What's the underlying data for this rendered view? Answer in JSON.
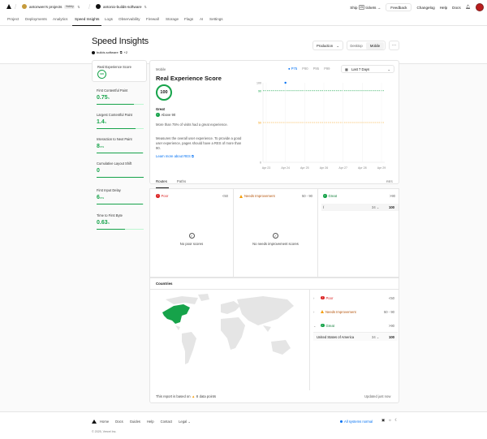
{
  "topbar": {
    "team_name": "antonwen's projects",
    "team_plan": "Hobby",
    "project_name": "antonio-builds-software",
    "ship_label": "Ship",
    "ship_badge": "25",
    "tickets_label": "tickets →",
    "feedback_label": "Feedback",
    "changelog_label": "Changelog",
    "help_label": "Help",
    "docs_label": "Docs"
  },
  "tabs": [
    "Project",
    "Deployments",
    "Analytics",
    "Speed Insights",
    "Logs",
    "Observability",
    "Firewall",
    "Storage",
    "Flags",
    "AI",
    "Settings"
  ],
  "active_tab": "Speed Insights",
  "header": {
    "title": "Speed Insights",
    "domain": "builds.software",
    "domain_extra": "+2",
    "environment": "Production",
    "device_options": [
      "Desktop",
      "Mobile"
    ],
    "device_selected": "Mobile"
  },
  "sidebar": {
    "metrics": [
      {
        "name": "Real Experience Score",
        "value": "100",
        "unit": "",
        "progress": 1.0
      },
      {
        "name": "First Contentful Paint",
        "value": "0.75",
        "unit": "s",
        "progress": 0.8
      },
      {
        "name": "Largest Contentful Paint",
        "value": "1.4",
        "unit": "s",
        "progress": 0.82
      },
      {
        "name": "Interaction to Next Paint",
        "value": "8",
        "unit": "ms",
        "progress": 0.98
      },
      {
        "name": "Cumulative Layout Shift",
        "value": "0",
        "unit": "",
        "progress": 1.0
      },
      {
        "name": "First Input Delay",
        "value": "6",
        "unit": "ms",
        "progress": 0.98
      },
      {
        "name": "Time to First Byte",
        "value": "0.63",
        "unit": "s",
        "progress": 0.6
      }
    ]
  },
  "panel": {
    "device_label": "Mobile",
    "title": "Real Experience Score",
    "score": "100",
    "rating": "Great",
    "above": "Above 90",
    "description": "More than 75% of visits had a great experience.",
    "explanation": "Measures the overall user experience. To provide a good user experience, pages should have a RES of more than 90.",
    "learn_more": "Learn more about RES ⧉",
    "percentiles": [
      "P75",
      "P90",
      "P95",
      "P99"
    ],
    "percentile_selected": "P75",
    "range": "Last 7 Days"
  },
  "chart_data": {
    "type": "line",
    "x": [
      "Apr 23",
      "Apr 24",
      "Apr 25",
      "Apr 26",
      "Apr 27",
      "Apr 28",
      "Apr 29"
    ],
    "series": [
      {
        "values": [
          null,
          100,
          null,
          null,
          null,
          null,
          null
        ]
      }
    ],
    "ylim": [
      0,
      100
    ],
    "yticks": [
      0,
      50,
      90,
      100
    ],
    "thresholds": [
      {
        "value": 90,
        "color": "#16a34a"
      },
      {
        "value": 50,
        "color": "#f59e0b"
      }
    ],
    "accent": "#0070f3"
  },
  "routes": {
    "tabs": [
      "Routes",
      "Paths"
    ],
    "selected": "Routes",
    "metric_tag": "RES",
    "buckets": [
      {
        "label": "Poor",
        "range": "<50",
        "empty_text": "No poor scores"
      },
      {
        "label": "Needs Improvement",
        "range": "50 - 90",
        "empty_text": "No needs improvement scores"
      },
      {
        "label": "Great",
        "range": ">90"
      }
    ],
    "great_rows": [
      {
        "route": "/",
        "count": "34",
        "score": "100"
      }
    ]
  },
  "countries": {
    "title": "Countries",
    "buckets": [
      {
        "label": "Poor",
        "range": "<50"
      },
      {
        "label": "Needs Improvement",
        "range": "50 - 90"
      },
      {
        "label": "Great",
        "range": ">90"
      }
    ],
    "great_rows": [
      {
        "country": "United States of America",
        "count": "34",
        "score": "100"
      }
    ],
    "footnote_prefix": "This report is based on",
    "footnote_count": "8",
    "footnote_suffix": "data points",
    "updated": "Updated just now"
  },
  "footer": {
    "links": [
      "Home",
      "Docs",
      "Guides",
      "Help",
      "Contact",
      "Legal ⌄"
    ],
    "status": "All systems normal",
    "copyright": "© 2025, Vercel Inc."
  },
  "colors": {
    "good": "#16a34a",
    "warn": "#f59e0b",
    "poor": "#dc2626",
    "accent": "#0070f3"
  }
}
